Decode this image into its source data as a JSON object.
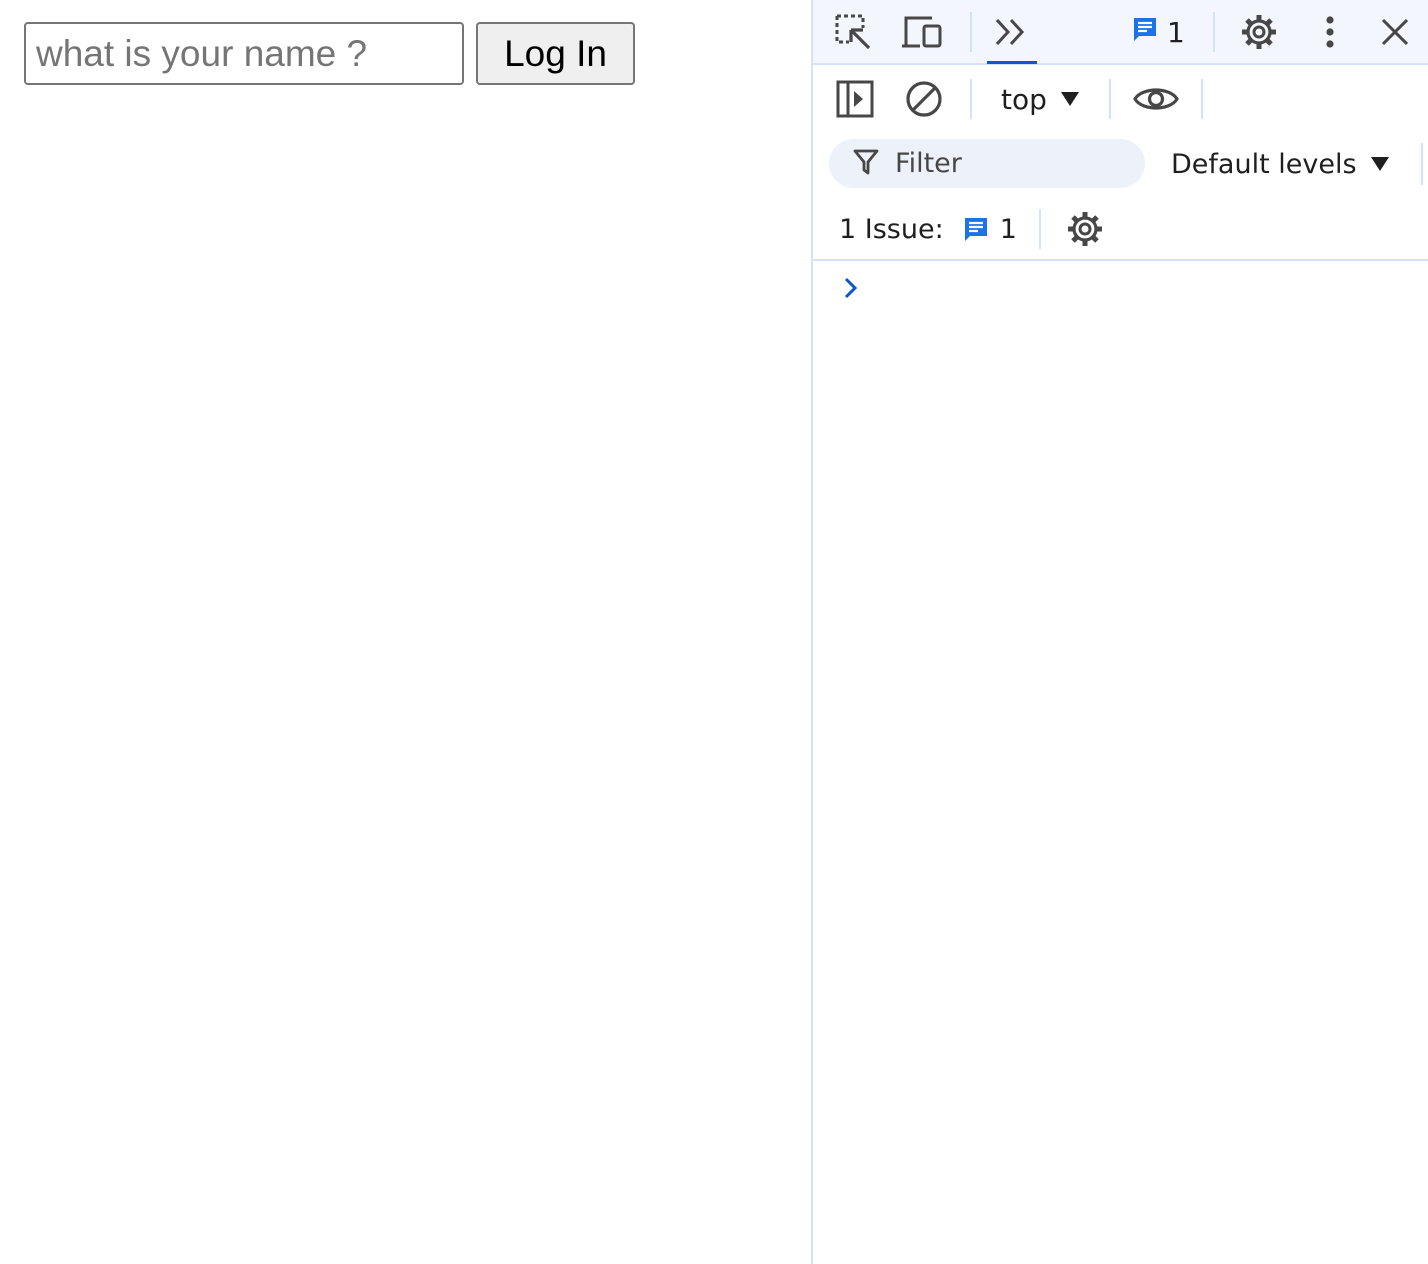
{
  "page": {
    "name_input": {
      "placeholder": "what is your name ?",
      "value": ""
    },
    "login_button": {
      "label": "Log In"
    }
  },
  "devtools": {
    "top_toolbar": {
      "icons": [
        "inspect-element-icon",
        "device-toolbar-icon",
        "more-tabs-icon",
        "issues-message-icon",
        "settings-gear-icon",
        "more-options-icon",
        "close-icon"
      ],
      "issues_count": "1"
    },
    "console_toolbar": {
      "icons": [
        "sidebar-toggle-icon",
        "clear-console-icon",
        "live-expression-eye-icon"
      ],
      "context": "top"
    },
    "filter": {
      "placeholder": "Filter",
      "levels_label": "Default levels"
    },
    "issues_bar": {
      "label": "1 Issue:",
      "count": "1"
    },
    "colors": {
      "accent": "#0b57d0",
      "toolbar_bg": "#f3f6fc",
      "divider": "#d3e3fd",
      "filter_bg": "#edf2fa",
      "issue_icon": "#1a73e8"
    }
  }
}
